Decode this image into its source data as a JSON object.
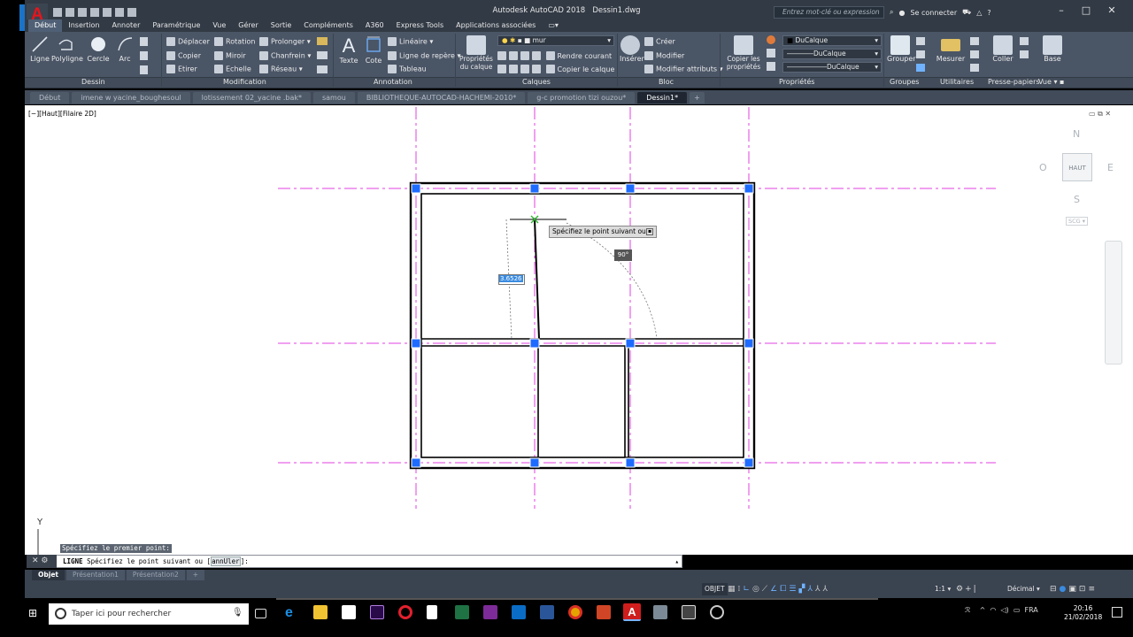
{
  "titlebar": {
    "app_title": "Autodesk AutoCAD 2018",
    "doc_title": "Dessin1.dwg",
    "search_placeholder": "Entrez mot-clé ou expression",
    "signin": "Se connecter"
  },
  "tabs": [
    "Début",
    "Insertion",
    "Annoter",
    "Paramétrique",
    "Vue",
    "Gérer",
    "Sortie",
    "Compléments",
    "A360",
    "Express Tools",
    "Applications associées"
  ],
  "ribbon": {
    "dessin": {
      "ligne": "Ligne",
      "polyligne": "Polyligne",
      "cercle": "Cercle",
      "arc": "Arc",
      "panel": "Dessin"
    },
    "modification": {
      "deplacer": "Déplacer",
      "rotation": "Rotation",
      "prolonger": "Prolonger",
      "copier": "Copier",
      "miroir": "Miroir",
      "chanfrein": "Chanfrein",
      "etirer": "Etirer",
      "echelle": "Echelle",
      "reseau": "Réseau",
      "panel": "Modification"
    },
    "annotation": {
      "texte": "Texte",
      "cote": "Cote",
      "lineaire": "Linéaire",
      "ligne_repere": "Ligne de repère",
      "tableau": "Tableau",
      "panel": "Annotation"
    },
    "calques": {
      "proprietes": "Propriétés du calque",
      "current_layer": "mur",
      "rendre_courant": "Rendre courant",
      "copier_calque": "Copier le calque",
      "panel": "Calques"
    },
    "bloc": {
      "inserer": "Insérer",
      "creer": "Créer",
      "modifier": "Modifier",
      "modifier_attributs": "Modifier attributs",
      "panel": "Bloc"
    },
    "proprietes": {
      "copier_proprietes": "Copier les propriétés",
      "color": "DuCalque",
      "linetype": "DuCalque",
      "lineweight": "DuCalque",
      "panel": "Propriétés"
    },
    "groupes": {
      "grouper": "Grouper",
      "panel": "Groupes"
    },
    "utilitaires": {
      "mesurer": "Mesurer",
      "panel": "Utilitaires"
    },
    "presse_papiers": {
      "coller": "Coller",
      "panel": "Presse-papiers"
    },
    "vue": {
      "base": "Base",
      "panel": "Vue"
    }
  },
  "doc_tabs": [
    "Début",
    "imene w yacine_boughesoul",
    "lotissement 02_yacine .bak*",
    "samou",
    "BIBLIOTHEQUE-AUTOCAD-HACHEMI-2010*",
    "g-c promotion tizi ouzou*",
    "Dessin1*"
  ],
  "viewport_label": "[−][Haut][Filaire 2D]",
  "navcube": {
    "n": "N",
    "s": "S",
    "e": "E",
    "w": "O",
    "top": "HAUT",
    "ucs": "SCG"
  },
  "dynamic_input": {
    "prompt": "Spécifiez le point suivant ou",
    "length": "3.6526",
    "angle": "90°"
  },
  "command": {
    "history": "Spécifiez le premier point:",
    "current_cmd": "LIGNE",
    "current_prompt": "Spécifiez le point suivant ou [",
    "option": "annUler",
    "suffix": "]:"
  },
  "ucs_y": "Y",
  "layout_tabs": [
    "Objet",
    "Présentation1",
    "Présentation2"
  ],
  "status": {
    "model": "OBJET",
    "scale": "1:1",
    "units": "Décimal"
  },
  "taskbar": {
    "search": "Taper ici pour rechercher",
    "lang": "FRA",
    "time": "20:16",
    "date": "21/02/2018"
  },
  "colors": {
    "accent": "#3a8be0",
    "grip": "#1e6bff",
    "axis": "#e040e0",
    "ribbon": "#4a5566"
  }
}
